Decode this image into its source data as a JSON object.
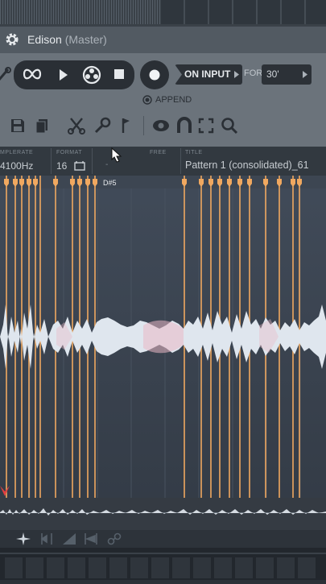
{
  "window": {
    "title": "Edison",
    "subtitle": "(Master)"
  },
  "record": {
    "mode_label": "ON INPUT",
    "for_label": "FOR",
    "duration": "30'",
    "append_label": "APPEND"
  },
  "info": {
    "samplerate_label": "MPLERATE",
    "samplerate_value": "4100Hz",
    "format_label": "FORMAT",
    "format_value": "16",
    "free_label": "FREE",
    "title_label": "TITLE",
    "title_value": "Pattern 1 (consolidated)_61",
    "dash_value": "-"
  },
  "waveform": {
    "marker_label": "D#5",
    "accent": "#f0a860",
    "wave_color": "#dfe6ee"
  },
  "colors": {
    "panel": "#6b737b",
    "button": "#2a2f35",
    "titlebar": "#525a62"
  }
}
